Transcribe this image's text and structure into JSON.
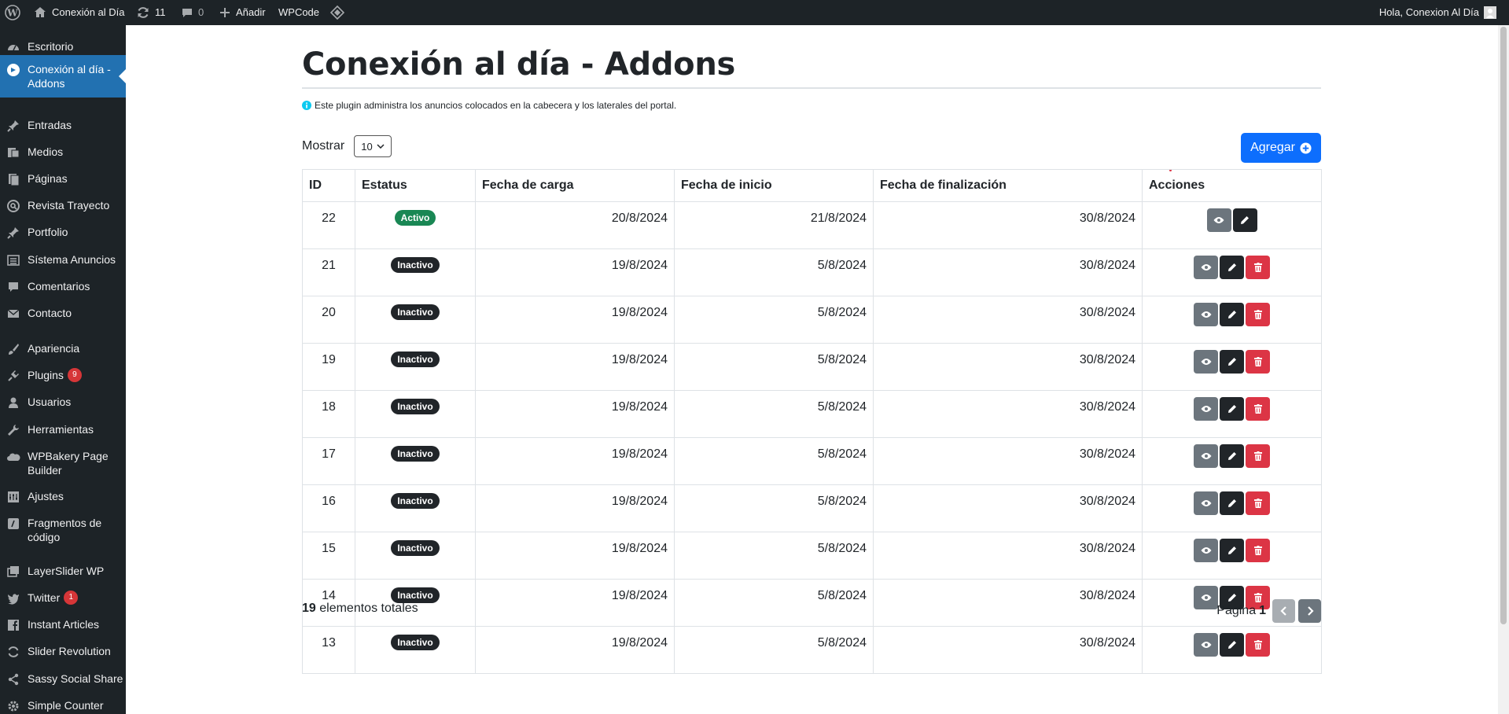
{
  "adminbar": {
    "site_name": "Conexión al Día",
    "updates_count": "11",
    "comments_count": "0",
    "add_new_label": "Añadir",
    "wpcode_label": "WPCode",
    "greeting": "Hola, Conexion Al Día"
  },
  "sidebar": {
    "items": [
      {
        "label": "Escritorio",
        "icon": "dashboard-icon"
      },
      {
        "label": "Conexión al día - Addons",
        "icon": "addons-icon"
      },
      {
        "label": "Entradas",
        "icon": "pin-icon"
      },
      {
        "label": "Medios",
        "icon": "media-icon"
      },
      {
        "label": "Páginas",
        "icon": "pages-icon"
      },
      {
        "label": "Revista Trayecto",
        "icon": "search-circle-icon"
      },
      {
        "label": "Portfolio",
        "icon": "pin-icon"
      },
      {
        "label": "Sístema Anuncios",
        "icon": "list-icon"
      },
      {
        "label": "Comentarios",
        "icon": "comment-icon"
      },
      {
        "label": "Contacto",
        "icon": "mail-icon"
      },
      {
        "label": "Apariencia",
        "icon": "brush-icon"
      },
      {
        "label": "Plugins",
        "icon": "plugin-icon",
        "badge": "9"
      },
      {
        "label": "Usuarios",
        "icon": "user-icon"
      },
      {
        "label": "Herramientas",
        "icon": "wrench-icon"
      },
      {
        "label": "WPBakery Page Builder",
        "icon": "cloud-icon"
      },
      {
        "label": "Ajustes",
        "icon": "settings-icon"
      },
      {
        "label": "Fragmentos de código",
        "icon": "code-icon"
      },
      {
        "label": "LayerSlider WP",
        "icon": "layers-icon"
      },
      {
        "label": "Twitter",
        "icon": "twitter-icon",
        "badge": "1"
      },
      {
        "label": "Instant Articles",
        "icon": "facebook-icon"
      },
      {
        "label": "Slider Revolution",
        "icon": "refresh-icon"
      },
      {
        "label": "Sassy Social Share",
        "icon": "share-icon"
      },
      {
        "label": "Simple Counter",
        "icon": "gear-icon"
      }
    ]
  },
  "main": {
    "title": "Conexión al día - Addons",
    "info_text": "Este plugin administra los anuncios colocados en la cabecera y los laterales del portal.",
    "mostrar_label": "Mostrar",
    "page_size": "10",
    "agregar_label": "Agregar",
    "table": {
      "headers": [
        "ID",
        "Estatus",
        "Fecha de carga",
        "Fecha de inicio",
        "Fecha de finalización",
        "Acciones"
      ],
      "rows": [
        {
          "id": "22",
          "status": "Activo",
          "carga": "20/8/2024",
          "inicio": "21/8/2024",
          "fin": "30/8/2024"
        },
        {
          "id": "21",
          "status": "Inactivo",
          "carga": "19/8/2024",
          "inicio": "5/8/2024",
          "fin": "30/8/2024"
        },
        {
          "id": "20",
          "status": "Inactivo",
          "carga": "19/8/2024",
          "inicio": "5/8/2024",
          "fin": "30/8/2024"
        },
        {
          "id": "19",
          "status": "Inactivo",
          "carga": "19/8/2024",
          "inicio": "5/8/2024",
          "fin": "30/8/2024"
        },
        {
          "id": "18",
          "status": "Inactivo",
          "carga": "19/8/2024",
          "inicio": "5/8/2024",
          "fin": "30/8/2024"
        },
        {
          "id": "17",
          "status": "Inactivo",
          "carga": "19/8/2024",
          "inicio": "5/8/2024",
          "fin": "30/8/2024"
        },
        {
          "id": "16",
          "status": "Inactivo",
          "carga": "19/8/2024",
          "inicio": "5/8/2024",
          "fin": "30/8/2024"
        },
        {
          "id": "15",
          "status": "Inactivo",
          "carga": "19/8/2024",
          "inicio": "5/8/2024",
          "fin": "30/8/2024"
        },
        {
          "id": "14",
          "status": "Inactivo",
          "carga": "19/8/2024",
          "inicio": "5/8/2024",
          "fin": "30/8/2024"
        },
        {
          "id": "13",
          "status": "Inactivo",
          "carga": "19/8/2024",
          "inicio": "5/8/2024",
          "fin": "30/8/2024"
        }
      ]
    },
    "total_count": "19",
    "total_label": "elementos totales",
    "pagina_label": "Página",
    "current_page": "1"
  },
  "colors": {
    "adminbar_bg": "#1d2327",
    "sidebar_current": "#2271b1",
    "primary": "#0d6efd",
    "success": "#198754",
    "danger": "#dc3545",
    "secondary": "#6c757d",
    "dark": "#212529"
  }
}
